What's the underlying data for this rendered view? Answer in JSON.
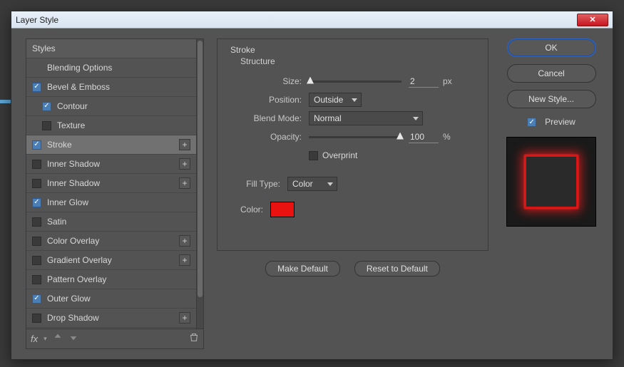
{
  "dialog": {
    "title": "Layer Style"
  },
  "sidebar": {
    "header": "Styles",
    "items": [
      {
        "label": "Blending Options",
        "checked": null,
        "plus": false,
        "indent": 0
      },
      {
        "label": "Bevel & Emboss",
        "checked": true,
        "plus": false,
        "indent": 0
      },
      {
        "label": "Contour",
        "checked": true,
        "plus": false,
        "indent": 1
      },
      {
        "label": "Texture",
        "checked": false,
        "plus": false,
        "indent": 1
      },
      {
        "label": "Stroke",
        "checked": true,
        "plus": true,
        "indent": 0,
        "selected": true
      },
      {
        "label": "Inner Shadow",
        "checked": false,
        "plus": true,
        "indent": 0
      },
      {
        "label": "Inner Shadow",
        "checked": false,
        "plus": true,
        "indent": 0
      },
      {
        "label": "Inner Glow",
        "checked": true,
        "plus": false,
        "indent": 0
      },
      {
        "label": "Satin",
        "checked": false,
        "plus": false,
        "indent": 0
      },
      {
        "label": "Color Overlay",
        "checked": false,
        "plus": true,
        "indent": 0
      },
      {
        "label": "Gradient Overlay",
        "checked": false,
        "plus": true,
        "indent": 0
      },
      {
        "label": "Pattern Overlay",
        "checked": false,
        "plus": false,
        "indent": 0
      },
      {
        "label": "Outer Glow",
        "checked": true,
        "plus": false,
        "indent": 0
      },
      {
        "label": "Drop Shadow",
        "checked": false,
        "plus": true,
        "indent": 0
      }
    ],
    "footer_fx": "fx"
  },
  "panel": {
    "title": "Stroke",
    "section": "Structure",
    "size_label": "Size:",
    "size_value": "2",
    "size_unit": "px",
    "position_label": "Position:",
    "position_value": "Outside",
    "blend_label": "Blend Mode:",
    "blend_value": "Normal",
    "opacity_label": "Opacity:",
    "opacity_value": "100",
    "opacity_unit": "%",
    "overprint_label": "Overprint",
    "filltype_label": "Fill Type:",
    "filltype_value": "Color",
    "color_label": "Color:",
    "color_value": "#ea1111",
    "make_default": "Make Default",
    "reset_default": "Reset to Default"
  },
  "right": {
    "ok": "OK",
    "cancel": "Cancel",
    "new_style": "New Style...",
    "preview": "Preview"
  }
}
